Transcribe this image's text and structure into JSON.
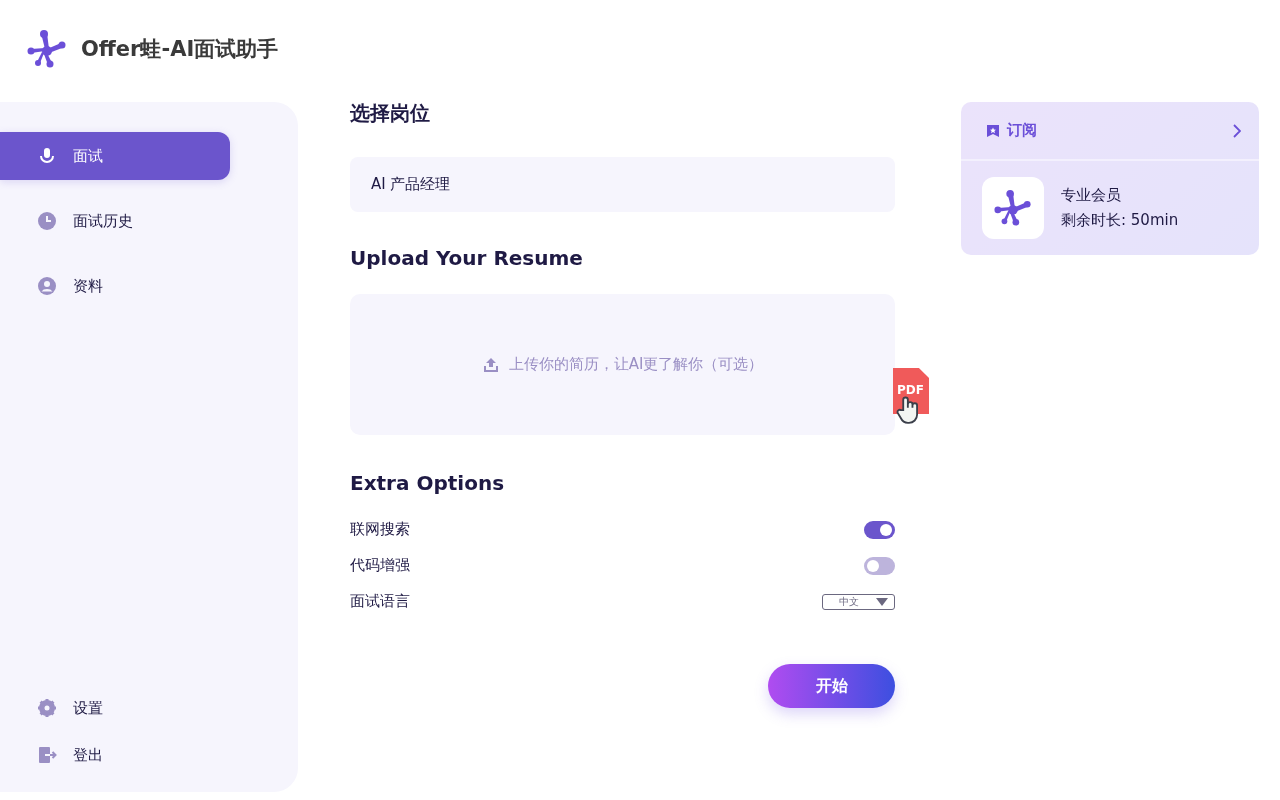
{
  "app": {
    "title": "Offer蛙-AI面试助手"
  },
  "sidebar": {
    "items": [
      {
        "label": "面试",
        "kind": "mic",
        "selected": true
      },
      {
        "label": "面试历史",
        "kind": "clock",
        "selected": false
      },
      {
        "label": "资料",
        "kind": "user",
        "selected": false
      }
    ],
    "footer_items": [
      {
        "label": "设置",
        "kind": "gear"
      },
      {
        "label": "登出",
        "kind": "logout"
      }
    ]
  },
  "position": {
    "heading": "选择岗位",
    "value": "AI 产品经理"
  },
  "resume": {
    "heading": "Upload Your Resume",
    "hint": "上传你的简历，让AI更了解你（可选）",
    "file_label": "PDF"
  },
  "options": {
    "heading": "Extra Options",
    "items": [
      {
        "label": "联网搜索",
        "kind": "toggle",
        "on": true
      },
      {
        "label": "代码增强",
        "kind": "toggle",
        "on": false
      },
      {
        "label": "面试语言",
        "kind": "select",
        "value": "中文"
      }
    ]
  },
  "start_button": "开始",
  "subscription": {
    "title": "订阅",
    "plan": "专业会员",
    "remaining": "剩余时长: 50min"
  }
}
